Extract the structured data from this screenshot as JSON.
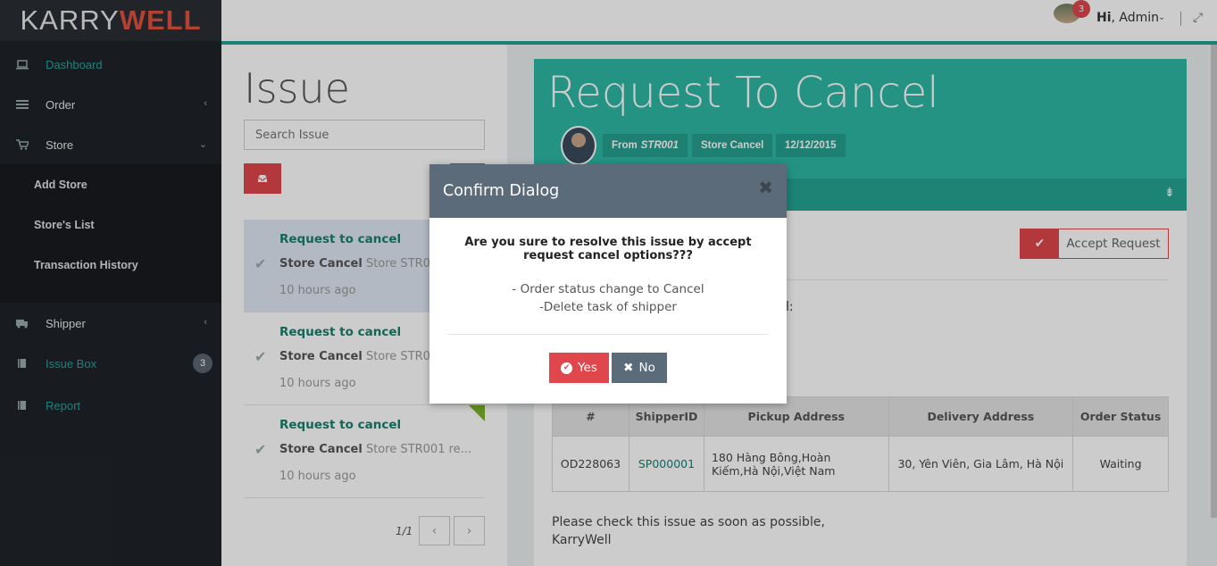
{
  "logo": {
    "part1": "KARRY",
    "part2": "WELL"
  },
  "sidebar": {
    "items": [
      {
        "label": "Dashboard"
      },
      {
        "label": "Order"
      },
      {
        "label": "Store"
      },
      {
        "label": "Shipper"
      },
      {
        "label": "Issue Box",
        "badge": "3"
      },
      {
        "label": "Report"
      }
    ],
    "store_sub": [
      {
        "label": "Add Store"
      },
      {
        "label": "Store's List"
      },
      {
        "label": "Transaction History"
      }
    ]
  },
  "topbar": {
    "notif_count": "3",
    "greeting": "Hi",
    "user": ", Admin"
  },
  "issue_list": {
    "title": "Issue",
    "search_placeholder": "Search Issue",
    "cards": [
      {
        "title": "Request to cancel",
        "store": "Store Cancel",
        "rest": " Store STR001 re...",
        "time": "10 hours ago"
      },
      {
        "title": "Request to cancel",
        "store": "Store Cancel",
        "rest": " Store STR001 re...",
        "time": "10 hours ago"
      },
      {
        "title": "Request to cancel",
        "store": "Store Cancel",
        "rest": " Store STR001 re...",
        "time": "10 hours ago"
      }
    ],
    "pager": "1/1",
    "prev": "‹",
    "next": "›"
  },
  "detail": {
    "title": "Request To Cancel",
    "tag_from": "From",
    "tag_from_id": "STR001",
    "tag_type": "Store Cancel",
    "tag_date": "12/12/2015",
    "accept_label": "Accept Request",
    "colon_text": "l:",
    "table": {
      "headers": [
        "#",
        "ShipperID",
        "Pickup Address",
        "Delivery Address",
        "Order Status"
      ],
      "rows": [
        [
          "OD228063",
          "SP000001",
          "180 Hàng Bông,Hoàn Kiếm,Hà Nội,Việt Nam",
          "30, Yên Viên, Gia Lâm, Hà Nội",
          "Waiting"
        ]
      ]
    },
    "footer_line1": "Please check this issue as soon as possible,",
    "footer_line2": "KarryWell"
  },
  "dialog": {
    "title": "Confirm Dialog",
    "close": "✖",
    "question": "Are you sure to resolve this issue by accept request cancel options???",
    "line1": "- Order status change to Cancel",
    "line2": "-Delete task of shipper",
    "yes": "Yes",
    "no": "No"
  },
  "colors": {
    "accent": "#2eb8a5",
    "danger": "#e0474c",
    "sidebar": "#1f2328"
  }
}
